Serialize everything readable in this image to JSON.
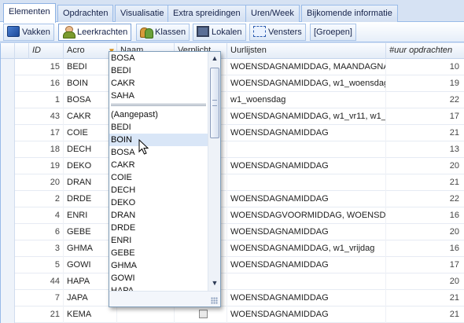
{
  "main_tabs": [
    "Elementen",
    "Opdrachten",
    "Visualisatie",
    "Extra spreidingen",
    "Uren/Week",
    "Bijkomende informatie"
  ],
  "sub_tabs": [
    {
      "label": "Vakken",
      "icon": "book-icon"
    },
    {
      "label": "Leerkrachten",
      "icon": "person-icon"
    },
    {
      "label": "Klassen",
      "icon": "group-icon"
    },
    {
      "label": "Lokalen",
      "icon": "room-icon"
    },
    {
      "label": "Vensters",
      "icon": "window-icon"
    },
    {
      "label": "[Groepen]",
      "icon": ""
    }
  ],
  "grid": {
    "columns": [
      "ID",
      "Acro",
      "Naam",
      "Verplicht",
      "Uurlijsten",
      "#uur opdrachten"
    ],
    "rows": [
      {
        "id": "15",
        "acro": "BEDI",
        "uurlijsten": "WOENSDAGNAMIDDAG,   MAANDAGNA",
        "uur": "10"
      },
      {
        "id": "16",
        "acro": "BOIN",
        "uurlijsten": "WOENSDAGNAMIDDAG,   w1_woensdag",
        "uur": "19"
      },
      {
        "id": "1",
        "acro": "BOSA",
        "uurlijsten": "w1_woensdag",
        "uur": "22"
      },
      {
        "id": "43",
        "acro": "CAKR",
        "uurlijsten": "WOENSDAGNAMIDDAG,   w1_vr11,  w1_",
        "uur": "17"
      },
      {
        "id": "17",
        "acro": "COIE",
        "uurlijsten": "WOENSDAGNAMIDDAG",
        "uur": "21"
      },
      {
        "id": "18",
        "acro": "DECH",
        "uurlijsten": "",
        "uur": "13"
      },
      {
        "id": "19",
        "acro": "DEKO",
        "uurlijsten": "WOENSDAGNAMIDDAG",
        "uur": "20"
      },
      {
        "id": "20",
        "acro": "DRAN",
        "uurlijsten": "",
        "uur": "21"
      },
      {
        "id": "2",
        "acro": "DRDE",
        "uurlijsten": "WOENSDAGNAMIDDAG",
        "uur": "22"
      },
      {
        "id": "4",
        "acro": "ENRI",
        "uurlijsten": "WOENSDAGVOORMIDDAG,   WOENSDA",
        "uur": "16"
      },
      {
        "id": "6",
        "acro": "GEBE",
        "uurlijsten": "WOENSDAGNAMIDDAG",
        "uur": "20"
      },
      {
        "id": "3",
        "acro": "GHMA",
        "uurlijsten": "WOENSDAGNAMIDDAG,   w1_vrijdag",
        "uur": "16"
      },
      {
        "id": "5",
        "acro": "GOWI",
        "uurlijsten": "WOENSDAGNAMIDDAG",
        "uur": "17"
      },
      {
        "id": "44",
        "acro": "HAPA",
        "uurlijsten": "",
        "uur": "20"
      },
      {
        "id": "7",
        "acro": "JAPA",
        "uurlijsten": "WOENSDAGNAMIDDAG",
        "uur": "21"
      },
      {
        "id": "21",
        "acro": "KEMA",
        "uurlijsten": "WOENSDAGNAMIDDAG",
        "uur": "21"
      }
    ]
  },
  "dropdown": {
    "top_items": [
      "BOSA",
      "BEDI",
      "CAKR",
      "SAHA"
    ],
    "list_items": [
      "(Aangepast)",
      "BEDI",
      "BOIN",
      "BOSA",
      "CAKR",
      "COIE",
      "DECH",
      "DEKO",
      "DRAN",
      "DRDE",
      "ENRI",
      "GEBE",
      "GHMA",
      "GOWI",
      "HAPA"
    ],
    "hovered": "BOIN"
  }
}
